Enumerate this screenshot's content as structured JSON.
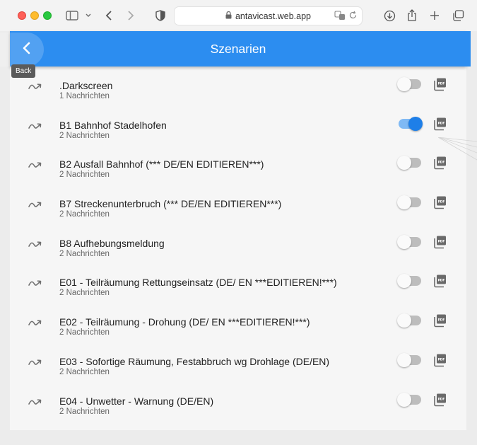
{
  "browser": {
    "url": "antavicast.web.app"
  },
  "appbar": {
    "title": "Szenarien",
    "back_tooltip": "Back"
  },
  "colors": {
    "primary": "#2c8df0",
    "switch_on": "#1e7fe8"
  },
  "scenarios": [
    {
      "title": ".Darkscreen",
      "subtitle": "1 Nachrichten",
      "active": false
    },
    {
      "title": "B1 Bahnhof Stadelhofen",
      "subtitle": "2 Nachrichten",
      "active": true
    },
    {
      "title": "B2 Ausfall Bahnhof (*** DE/EN EDITIEREN***)",
      "subtitle": "2 Nachrichten",
      "active": false
    },
    {
      "title": "B7 Streckenunterbruch (*** DE/EN EDITIEREN***)",
      "subtitle": "2 Nachrichten",
      "active": false
    },
    {
      "title": "B8 Aufhebungsmeldung",
      "subtitle": "2 Nachrichten",
      "active": false
    },
    {
      "title": "E01 - Teilräumung Rettungseinsatz (DE/ EN ***EDITIEREN!***)",
      "subtitle": "2 Nachrichten",
      "active": false
    },
    {
      "title": "E02 - Teilräumung - Drohung (DE/ EN ***EDITIEREN!***)",
      "subtitle": "2 Nachrichten",
      "active": false
    },
    {
      "title": "E03 - Sofortige Räumung, Festabbruch wg Drohlage (DE/EN)",
      "subtitle": "2 Nachrichten",
      "active": false
    },
    {
      "title": "E04 - Unwetter - Warnung (DE/EN)",
      "subtitle": "2 Nachrichten",
      "active": false
    }
  ]
}
